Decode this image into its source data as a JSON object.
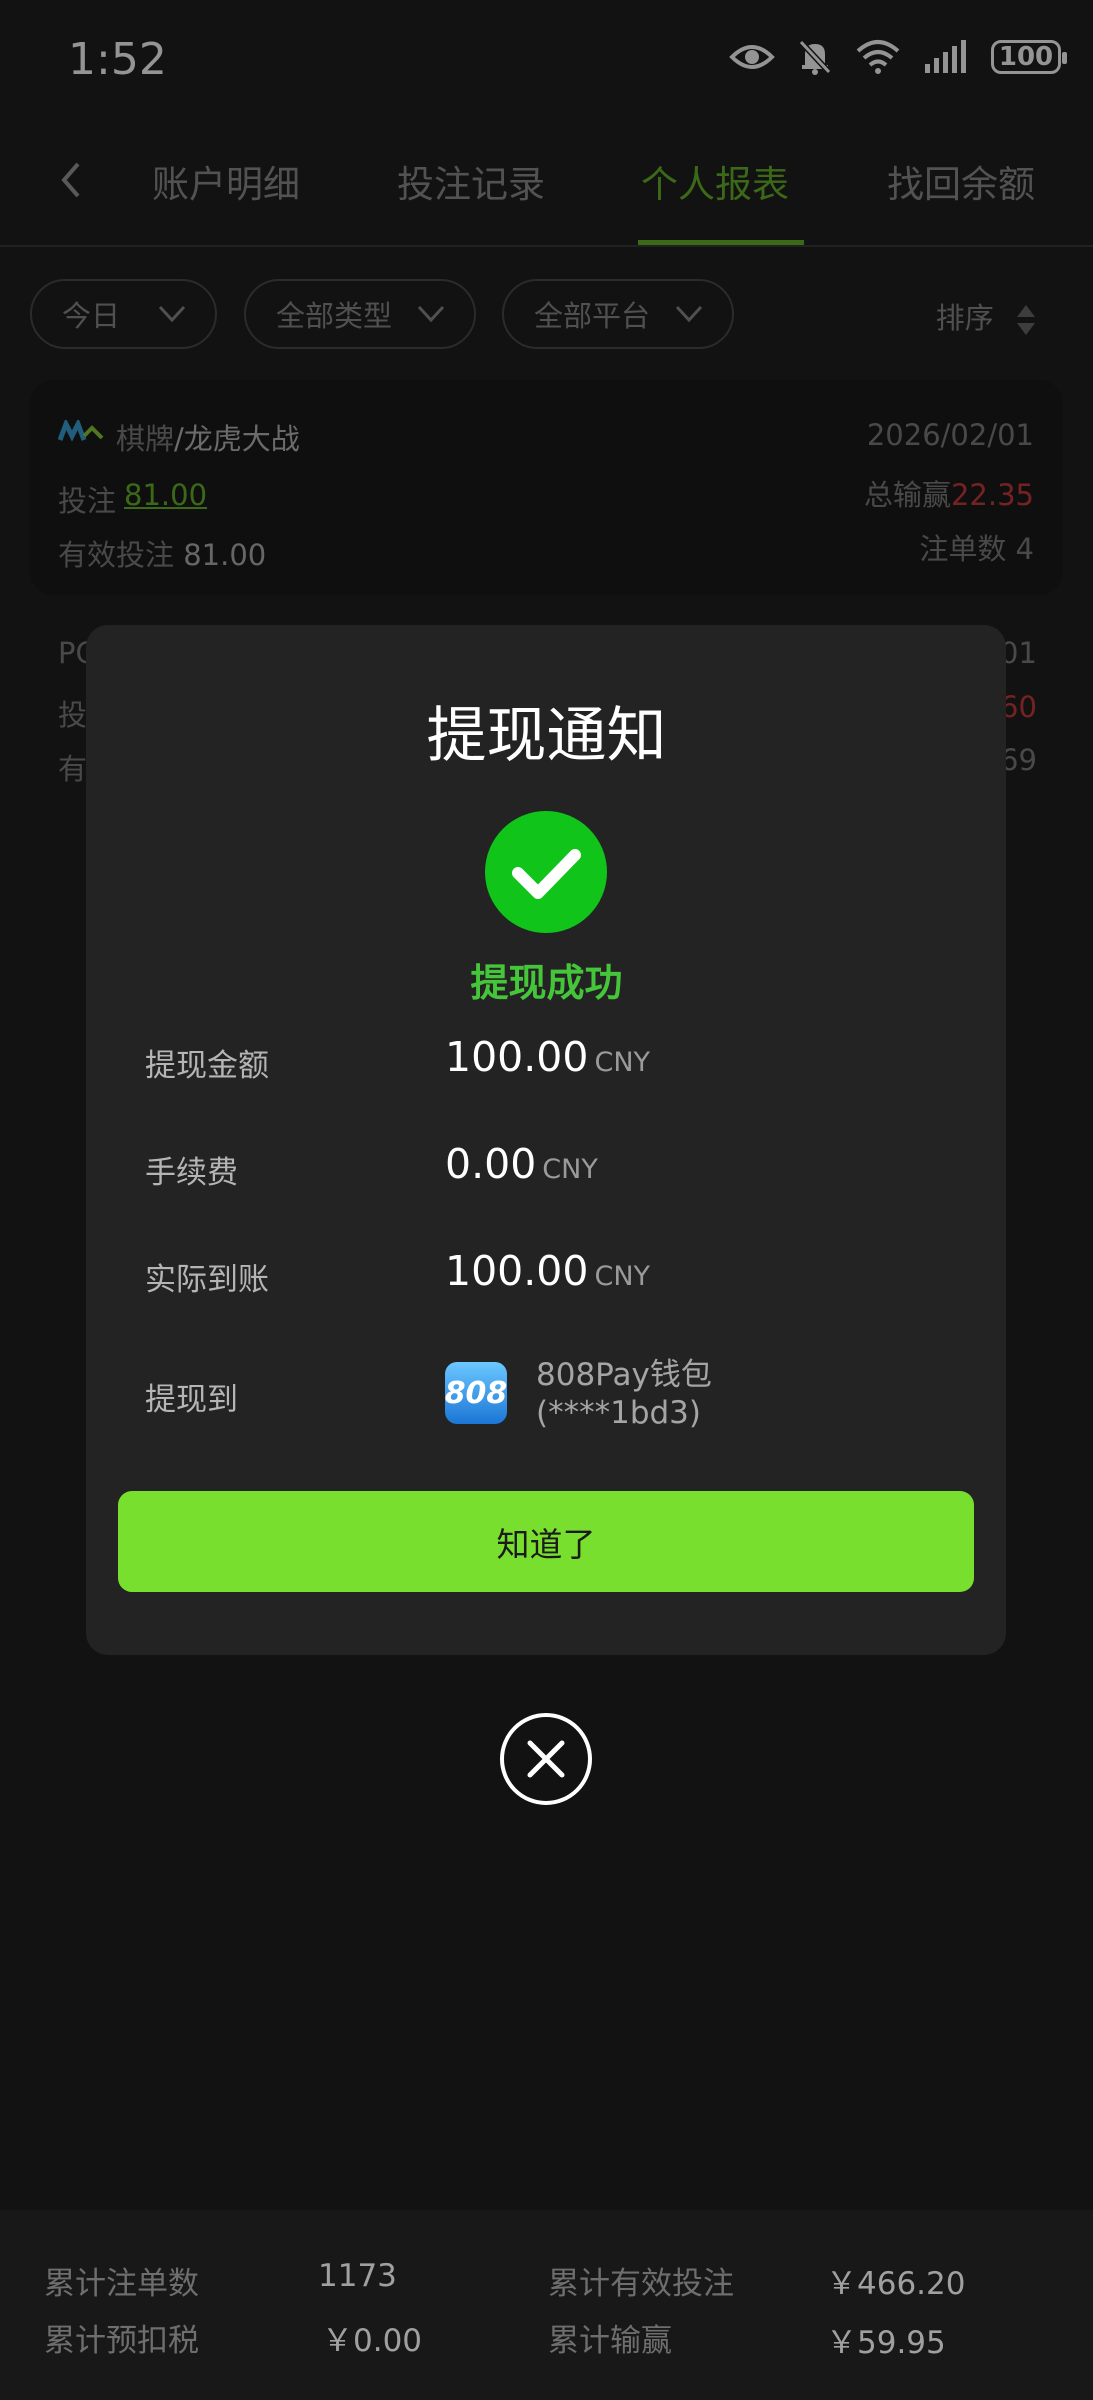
{
  "status_bar": {
    "time": "1:52",
    "battery": "100"
  },
  "tabs": [
    {
      "label": "账户明细",
      "active": false
    },
    {
      "label": "投注记录",
      "active": false
    },
    {
      "label": "个人报表",
      "active": true
    },
    {
      "label": "找回余额",
      "active": false
    }
  ],
  "filters": {
    "date": "今日",
    "type": "全部类型",
    "platform": "全部平台",
    "sort": "排序"
  },
  "records": [
    {
      "category": "棋牌",
      "game": "/龙虎大战",
      "date": "2026/02/01",
      "bet_label": "投注",
      "bet": "81.00",
      "total_win_label": "总输赢",
      "total_win": "22.35",
      "valid_bet_label": "有效投注",
      "valid_bet": "81.00",
      "order_count_label": "注单数",
      "order_count": "4"
    },
    {
      "prefix_visible": "PG",
      "bet_label_partial": "投",
      "valid_label_partial": "有",
      "date_tail": "01",
      "win_tail": "60",
      "count_tail": "69"
    }
  ],
  "modal": {
    "title": "提现通知",
    "status": "提现成功",
    "rows": [
      {
        "label": "提现金额",
        "value": "100.00",
        "unit": "CNY"
      },
      {
        "label": "手续费",
        "value": "0.00",
        "unit": "CNY"
      },
      {
        "label": "实际到账",
        "value": "100.00",
        "unit": "CNY"
      }
    ],
    "withdraw_to_label": "提现到",
    "wallet_icon_text": "808",
    "wallet_name": "808Pay钱包",
    "wallet_account": "(****1bd3)",
    "confirm_button": "知道了"
  },
  "summary": {
    "order_count_label": "累计注单数",
    "order_count": "1173",
    "valid_bet_label": "累计有效投注",
    "valid_bet": "￥466.20",
    "tax_label": "累计预扣税",
    "tax": "￥0.00",
    "win_label": "累计输赢",
    "win": "￥59.95"
  },
  "colors": {
    "accent": "#67b52a",
    "success": "#10c41a",
    "button": "#79df2f",
    "loss": "#cc3b3b"
  }
}
